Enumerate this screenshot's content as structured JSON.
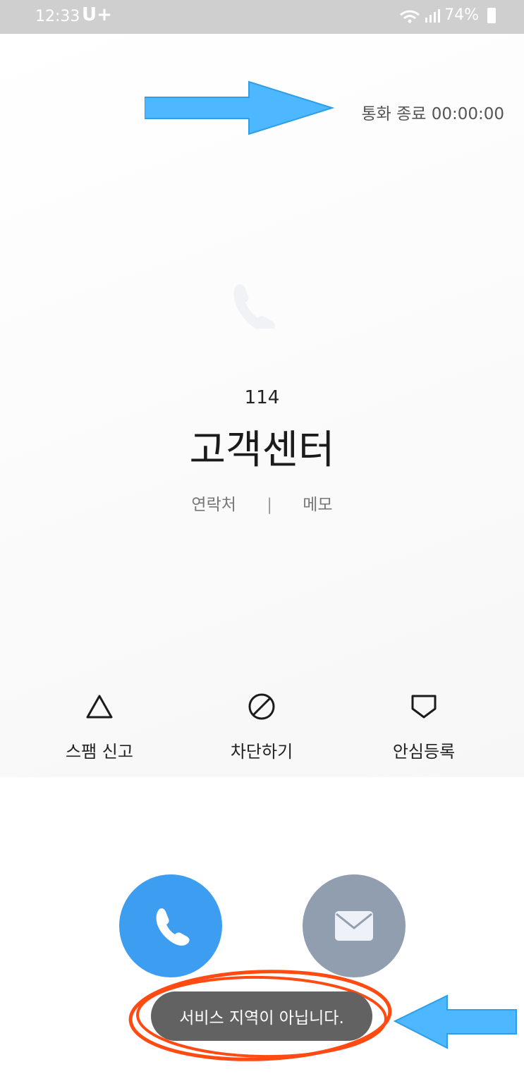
{
  "status_bar": {
    "time": "12:33",
    "carrier": "U+",
    "battery": "74%",
    "icons": [
      "wifi-calling-icon",
      "signal-icon",
      "battery-icon"
    ]
  },
  "call": {
    "status_text": "통화 종료 00:00:00",
    "number": "114",
    "name": "고객센터",
    "contact_link": "연락처",
    "separator": "|",
    "memo_link": "메모"
  },
  "actions": [
    {
      "label": "스팸 신고",
      "icon": "warning-triangle-icon"
    },
    {
      "label": "차단하기",
      "icon": "block-icon"
    },
    {
      "label": "안심등록",
      "icon": "shield-icon"
    }
  ],
  "buttons": {
    "call_icon": "phone-icon",
    "message_icon": "envelope-icon"
  },
  "toast": {
    "text": "서비스 지역이 아닙니다."
  },
  "colors": {
    "call_button": "#3d9df0",
    "message_button": "#919eaf",
    "toast_bg": "#626262",
    "annotation_arrow": "#4db8ff",
    "annotation_circle": "#ff4a12"
  }
}
